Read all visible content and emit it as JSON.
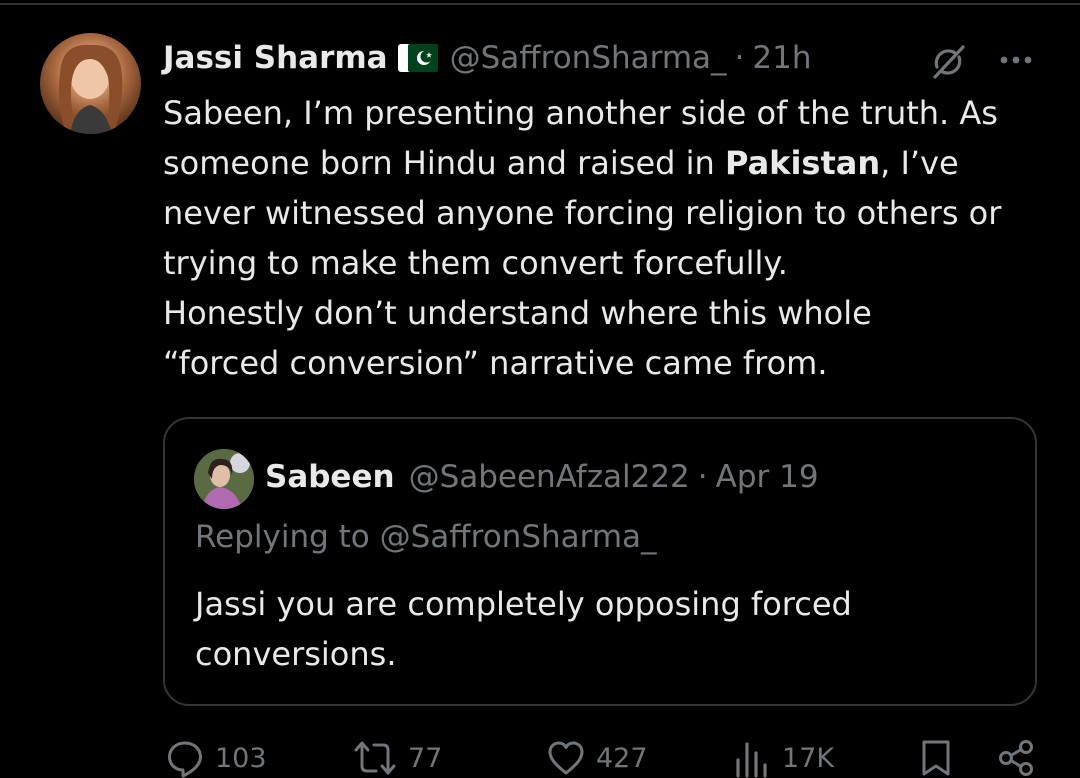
{
  "tweet": {
    "author_name": "Jassi Sharma",
    "flag_icon": "pakistan-flag-icon",
    "handle": "@SaffronSharma_",
    "separator": "·",
    "time": "21h",
    "text_lines": [
      {
        "before": "Sabeen, I’m presenting another side of the truth. As",
        "bold": "",
        "after": ""
      },
      {
        "before": "someone born Hindu and raised in ",
        "bold": "Pakistan",
        "after": ", I’ve"
      },
      {
        "before": "never witnessed anyone forcing religion to others or",
        "bold": "",
        "after": ""
      },
      {
        "before": "trying to make them convert forcefully.",
        "bold": "",
        "after": ""
      },
      {
        "before": "Honestly don’t understand where this whole",
        "bold": "",
        "after": ""
      },
      {
        "before": "“forced conversion” narrative came from.",
        "bold": "",
        "after": ""
      }
    ]
  },
  "quote": {
    "author_name": "Sabeen",
    "handle": "@SabeenAfzal222",
    "separator": "·",
    "date": "Apr 19",
    "replying_to": "Replying to @SaffronSharma_",
    "text_lines": [
      "Jassi you are completely opposing forced",
      "conversions."
    ]
  },
  "actions": {
    "replies": "103",
    "reposts": "77",
    "likes": "427",
    "views": "17K"
  },
  "colors": {
    "background": "#000000",
    "primary_text": "#e7e9ea",
    "secondary_text": "#71767b",
    "border": "#333639",
    "flag_green": "#01411c"
  }
}
